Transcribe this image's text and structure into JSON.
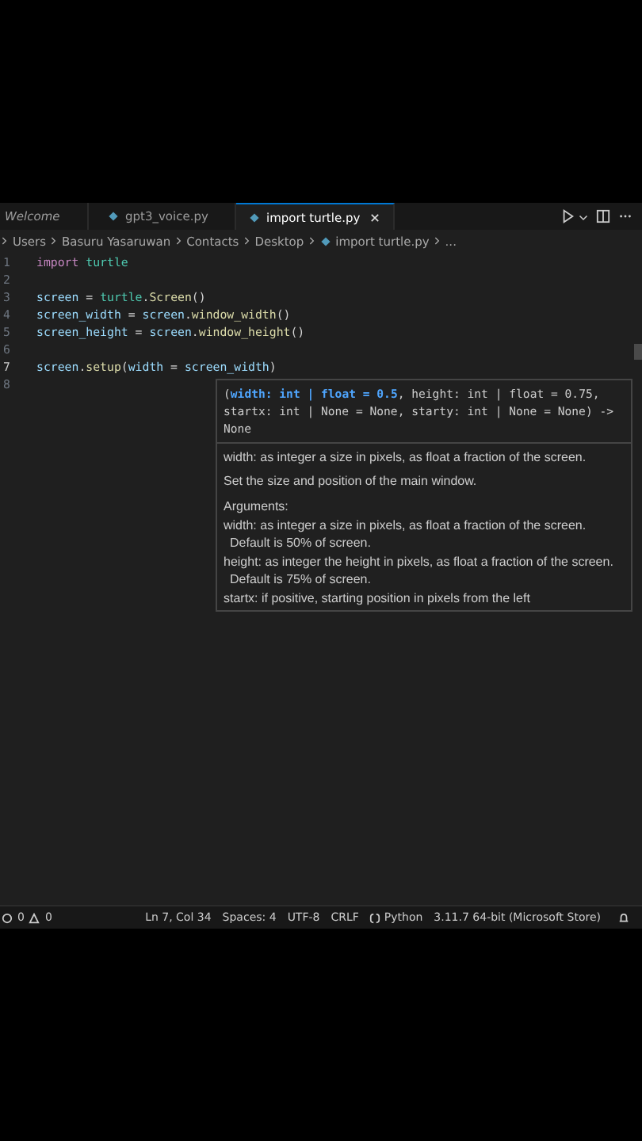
{
  "tabs": [
    {
      "label": "Welcome",
      "kind": "preview",
      "selected": false
    },
    {
      "label": "gpt3_voice.py",
      "kind": "python",
      "selected": false
    },
    {
      "label": "import turtle.py",
      "kind": "python",
      "selected": true
    }
  ],
  "breadcrumb": [
    "Users",
    "Basuru Yasaruwan",
    "Contacts",
    "Desktop",
    "import turtle.py",
    "..."
  ],
  "code_lines": [
    {
      "number": "1",
      "current": false,
      "tokens": [
        {
          "kind": "keyword",
          "text": "import"
        },
        {
          "kind": "module",
          "text": " turtle"
        }
      ]
    },
    {
      "number": "2",
      "current": false
    },
    {
      "number": "3",
      "current": false,
      "tokens": [
        {
          "kind": "variable",
          "text": "screen"
        },
        {
          "kind": "plain",
          "text": " = "
        },
        {
          "kind": "module",
          "text": "turtle"
        },
        {
          "kind": "plain",
          "text": "."
        },
        {
          "kind": "function",
          "text": "Screen"
        },
        {
          "kind": "plain",
          "text": "()"
        }
      ]
    },
    {
      "number": "4",
      "current": false,
      "tokens": [
        {
          "kind": "variable",
          "text": "screen_width"
        },
        {
          "kind": "plain",
          "text": " = "
        },
        {
          "kind": "variable",
          "text": "screen"
        },
        {
          "kind": "plain",
          "text": "."
        },
        {
          "kind": "function",
          "text": "window_width"
        },
        {
          "kind": "plain",
          "text": "()"
        }
      ]
    },
    {
      "number": "5",
      "current": false,
      "tokens": [
        {
          "kind": "variable",
          "text": "screen_height"
        },
        {
          "kind": "plain",
          "text": " = "
        },
        {
          "kind": "variable",
          "text": "screen"
        },
        {
          "kind": "plain",
          "text": "."
        },
        {
          "kind": "function",
          "text": "window_height"
        },
        {
          "kind": "plain",
          "text": "()"
        }
      ]
    },
    {
      "number": "6",
      "current": false
    },
    {
      "number": "7",
      "current": true,
      "tokens": [
        {
          "kind": "variable",
          "text": "screen"
        },
        {
          "kind": "plain",
          "text": "."
        },
        {
          "kind": "function",
          "text": "setup"
        },
        {
          "kind": "plain",
          "text": "("
        },
        {
          "kind": "variable",
          "text": "width"
        },
        {
          "kind": "plain",
          "text": " = "
        },
        {
          "kind": "variable",
          "text": "screen_width"
        },
        {
          "kind": "plain",
          "text": ")"
        }
      ]
    },
    {
      "number": "8",
      "current": false
    }
  ],
  "hover": {
    "signature": "(**width: int | float = 0.5**, height: int | float = 0.75, startx: int | None = None, starty: int | None = None) -> None",
    "paragraphs": [
      "width: as integer a size in pixels, as float a fraction of the screen.",
      "Set the size and position of the main window."
    ],
    "arguments_title": "Arguments:",
    "arguments": [
      "width: as integer a size in pixels, as float a fraction of the screen. Default is 50% of screen.",
      "height: as integer the height in pixels, as float a fraction of the screen. Default is 75% of screen.",
      "startx: if positive, starting position in pixels from the left"
    ]
  },
  "status_bar": {
    "errors": "0",
    "warnings": "0",
    "items": [
      {
        "kind": "text",
        "text": "Ln 7, Col 34"
      },
      {
        "kind": "text",
        "text": "Spaces: 4"
      },
      {
        "kind": "text",
        "text": "UTF-8"
      },
      {
        "kind": "text",
        "text": "CRLF"
      },
      {
        "kind": "language",
        "text": "Python"
      },
      {
        "kind": "text",
        "text": "3.11.7 64-bit (Microsoft Store)"
      }
    ]
  }
}
